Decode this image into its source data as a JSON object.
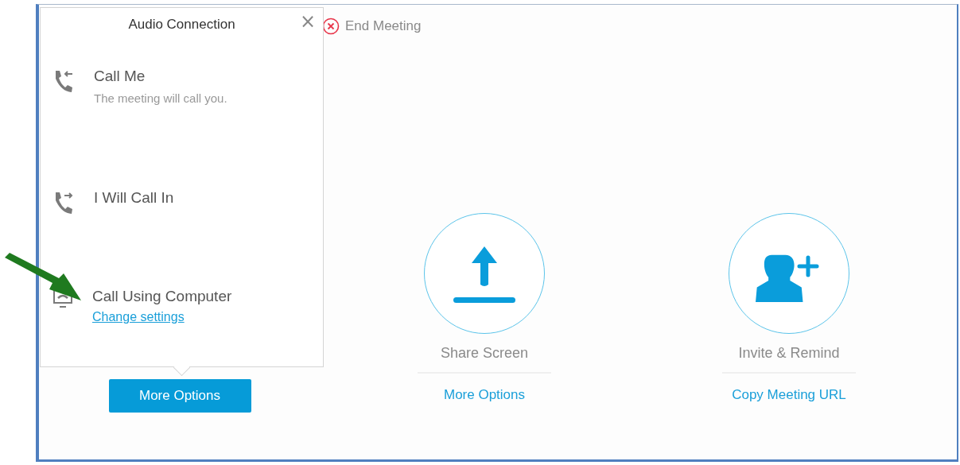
{
  "toolbar": {
    "end_meeting": "End Meeting"
  },
  "actions": [
    {
      "kind": "button",
      "action": "More Options"
    },
    {
      "kind": "share",
      "label": "Share Screen",
      "action": "More Options"
    },
    {
      "kind": "invite",
      "label": "Invite & Remind",
      "action": "Copy Meeting URL"
    }
  ],
  "popup": {
    "title": "Audio Connection",
    "close": "×",
    "options": [
      {
        "kind": "callback",
        "label": "Call Me",
        "description": "The meeting will call you."
      },
      {
        "kind": "dialin",
        "label": "I Will Call In"
      },
      {
        "kind": "computer",
        "label": "Call Using Computer",
        "link": "Change settings"
      }
    ]
  }
}
